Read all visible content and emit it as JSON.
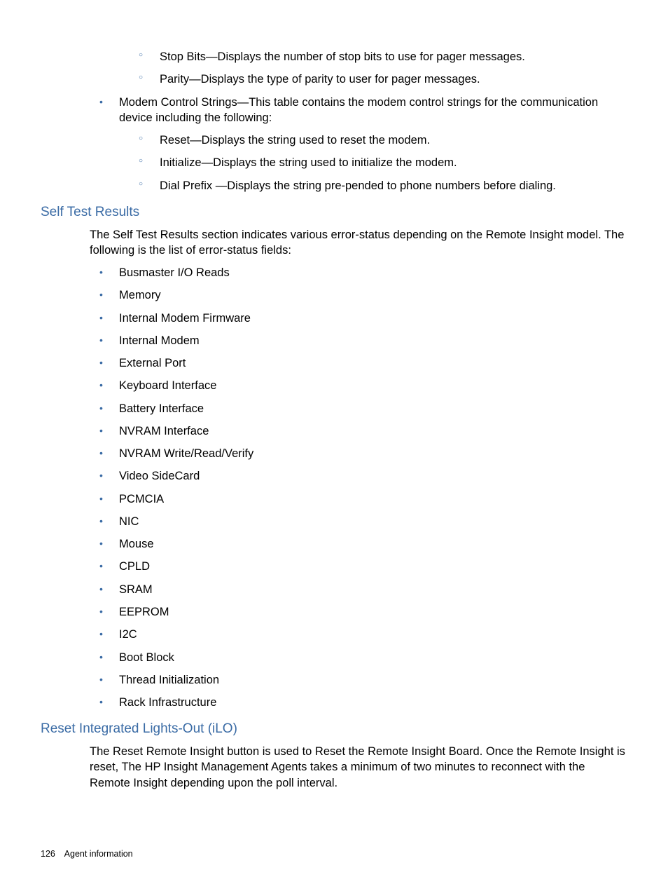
{
  "top": {
    "subItems": [
      "Stop Bits—Displays the number of stop bits to use for pager messages.",
      "Parity—Displays the type of parity to user for pager messages."
    ],
    "modemItem": "Modem Control Strings—This table contains the modem control strings for the communication device including the following:",
    "modemSubItems": [
      "Reset—Displays the string used to reset the modem.",
      "Initialize—Displays the string used to initialize the modem.",
      "Dial Prefix —Displays the string pre-pended to phone numbers before dialing."
    ]
  },
  "section1": {
    "heading": "Self Test Results",
    "intro": "The Self Test Results section indicates various error-status depending on the Remote Insight model.  The following is the list of error-status fields:",
    "items": [
      "Busmaster I/O Reads",
      "Memory",
      "Internal Modem Firmware",
      "Internal Modem",
      "External Port",
      "Keyboard Interface",
      "Battery Interface",
      "NVRAM Interface",
      "NVRAM Write/Read/Verify",
      "Video SideCard",
      "PCMCIA",
      "NIC",
      "Mouse",
      "CPLD",
      "SRAM",
      "EEPROM",
      "I2C",
      "Boot Block",
      "Thread Initialization",
      "Rack Infrastructure"
    ]
  },
  "section2": {
    "heading": "Reset Integrated Lights-Out (iLO)",
    "body": "The Reset Remote Insight button is used to Reset the Remote Insight Board.  Once the Remote Insight is reset, The HP Insight Management Agents takes a minimum of two minutes to reconnect with the Remote Insight depending upon the poll interval."
  },
  "footer": {
    "page": "126",
    "label": "Agent information"
  }
}
